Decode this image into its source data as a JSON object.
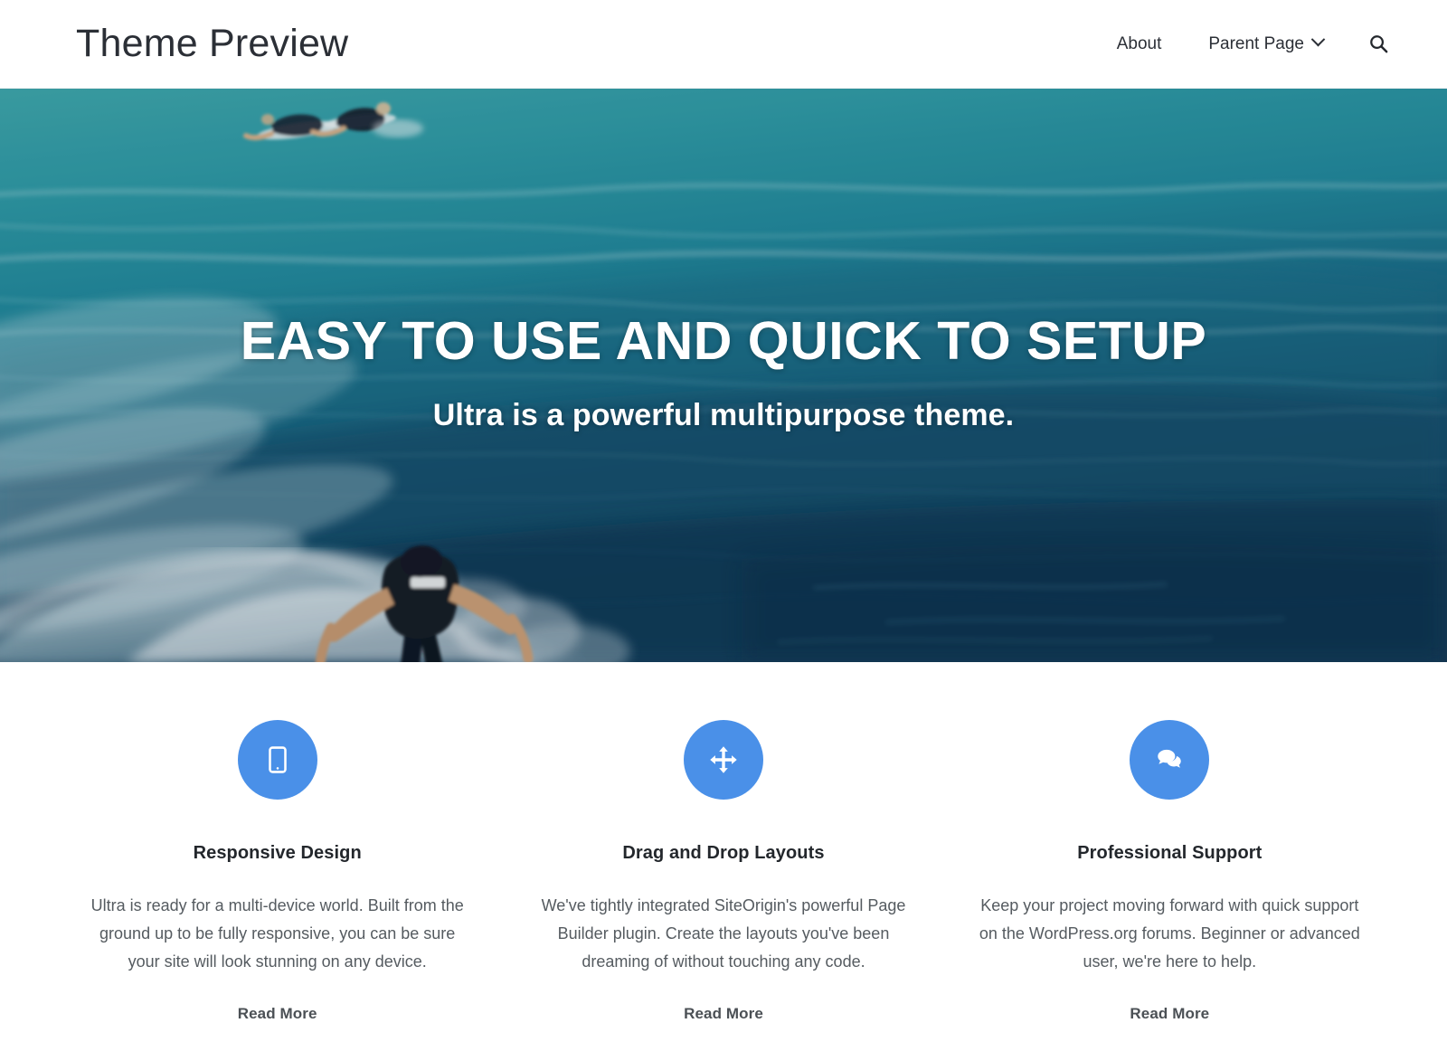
{
  "header": {
    "site_title": "Theme Preview",
    "nav": [
      {
        "label": "About",
        "has_dropdown": false
      },
      {
        "label": "Parent Page",
        "has_dropdown": true
      }
    ],
    "search_icon": "search-icon"
  },
  "hero": {
    "title": "EASY TO USE AND QUICK TO SETUP",
    "subtitle": "Ultra is a powerful multipurpose theme.",
    "image_description": "surfers riding an ocean wave",
    "colors": {
      "water_top": "#3fa3a8",
      "water_mid": "#1f7e92",
      "water_deep": "#123a59",
      "foam": "#e9f4f6"
    }
  },
  "features": {
    "accent_color": "#4a90e8",
    "items": [
      {
        "icon": "tablet-icon",
        "title": "Responsive Design",
        "text": "Ultra is ready for a multi-device world. Built from the ground up to be fully responsive, you can be sure your site will look stunning on any device.",
        "link_label": "Read More"
      },
      {
        "icon": "move-arrows-icon",
        "title": "Drag and Drop Layouts",
        "text": "We've tightly integrated SiteOrigin's powerful Page Builder plugin. Create the layouts you've been dreaming of without touching any code.",
        "link_label": "Read More"
      },
      {
        "icon": "comments-icon",
        "title": "Professional Support",
        "text": "Keep your project moving forward with quick support on the WordPress.org forums. Beginner or advanced user, we're here to help.",
        "link_label": "Read More"
      }
    ]
  }
}
